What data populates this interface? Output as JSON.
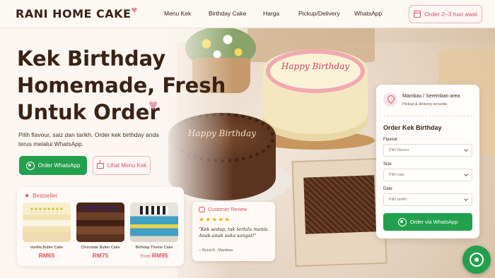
{
  "brand": {
    "name": "RANI HOME CAKE"
  },
  "nav": {
    "items": [
      {
        "label": "Menu Kek"
      },
      {
        "label": "Birthday Cake"
      },
      {
        "label": "Harga"
      },
      {
        "label": "Pickup/Delivery"
      },
      {
        "label": "WhatsApp"
      }
    ],
    "order_button": "Order 2–3 hari awal"
  },
  "hero": {
    "title_lines": [
      "Kek Birthday",
      "Homemade, Fresh",
      "Untuk Order"
    ],
    "subtitle": "Pilih flavour, saiz dan tarikh. Order kek birthday anda terus melalui WhatsApp.",
    "primary_button": "Order WhatsApp",
    "secondary_button": "Lihat Menu Kek"
  },
  "scene": {
    "cake_text_1": "Happy Birthday",
    "cake_text_2": "Happy Birthday"
  },
  "bestseller": {
    "title": "Bestseller",
    "products": [
      {
        "name": "Vanilla Butter Cake",
        "price": "RM65",
        "price_prefix": ""
      },
      {
        "name": "Chocolate Butter Cake",
        "price": "RM75",
        "price_prefix": ""
      },
      {
        "name": "Birthday Theme Cake",
        "price": "RM95",
        "price_prefix": "From"
      }
    ]
  },
  "review": {
    "title": "Customer Review",
    "rating": 5,
    "stars": "★★★★★",
    "quote": "\"Kek sedap, tak terlalu manis. Anak-anak suka sangat!\"",
    "author": "– Nurul A., Mambau"
  },
  "order_panel": {
    "location": "Mambau / Seremban area",
    "location_sub": "Pickup & delivery tersedia",
    "title": "Order Kek Birthday",
    "fields": [
      {
        "label": "Flavour",
        "placeholder": "Pilih flavour"
      },
      {
        "label": "Size",
        "placeholder": "Pilih saiz"
      },
      {
        "label": "Date",
        "placeholder": "Pilih tarikh"
      }
    ],
    "submit": "Order via WhatsApp"
  },
  "colors": {
    "accent": "#d6545e",
    "whatsapp": "#23a04d",
    "brown": "#3b2215"
  }
}
